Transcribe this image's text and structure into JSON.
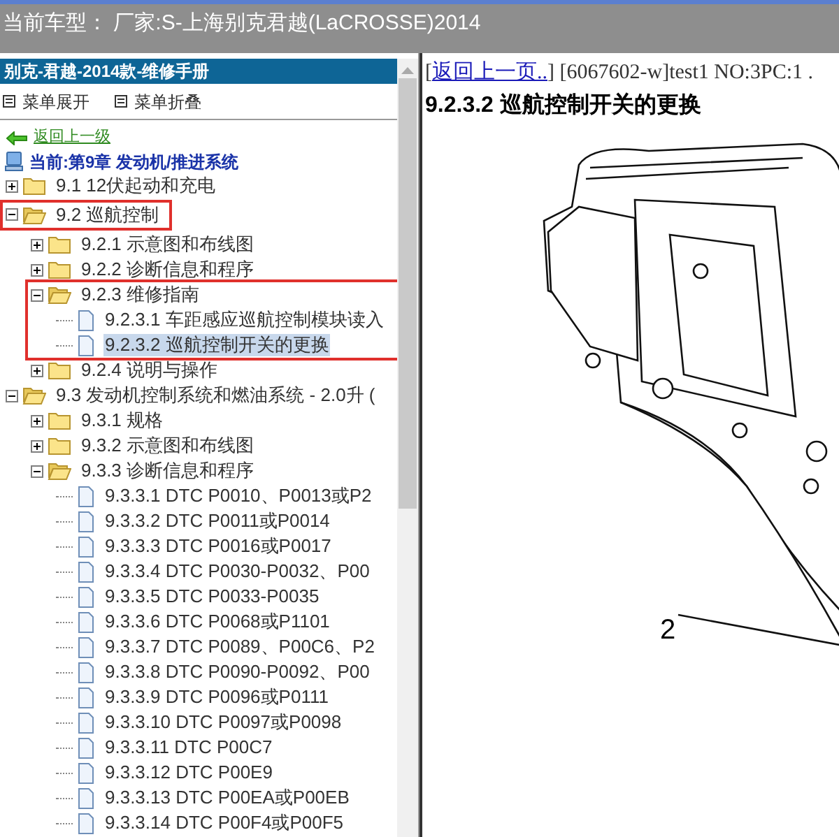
{
  "window": {
    "title": "当前车型： 厂家:S-上海别克君越(LaCROSSE)2014"
  },
  "sidebar": {
    "header": "别克-君越-2014款-维修手册",
    "menu": [
      {
        "label": "菜单展开"
      },
      {
        "label": "菜单折叠"
      }
    ],
    "back_link": "返回上一级",
    "current": "当前:第9章 发动机/推进系统",
    "tree": [
      {
        "kind": "folder",
        "label": "9.1 12伏起动和充电",
        "expanded": false,
        "selected": false
      },
      {
        "kind": "folder",
        "label": "9.2 巡航控制",
        "expanded": true,
        "selected": false,
        "highlighted": true,
        "frame_includes_children": false,
        "children": [
          {
            "kind": "folder",
            "label": "9.2.1 示意图和布线图",
            "expanded": false,
            "selected": false
          },
          {
            "kind": "folder",
            "label": "9.2.2 诊断信息和程序",
            "expanded": false,
            "selected": false
          },
          {
            "kind": "folder",
            "label": "9.2.3 维修指南",
            "expanded": true,
            "selected": false,
            "highlighted": true,
            "frame_includes_children": true,
            "children": [
              {
                "kind": "page",
                "label": "9.2.3.1 车距感应巡航控制模块读入",
                "selected": false
              },
              {
                "kind": "page",
                "label": "9.2.3.2 巡航控制开关的更换",
                "selected": true
              }
            ]
          },
          {
            "kind": "folder",
            "label": "9.2.4 说明与操作",
            "expanded": false,
            "selected": false
          }
        ]
      },
      {
        "kind": "folder",
        "label": "9.3 发动机控制系统和燃油系统 - 2.0升 (",
        "expanded": true,
        "selected": false,
        "children": [
          {
            "kind": "folder",
            "label": "9.3.1 规格",
            "expanded": false,
            "selected": false
          },
          {
            "kind": "folder",
            "label": "9.3.2 示意图和布线图",
            "expanded": false,
            "selected": false
          },
          {
            "kind": "folder",
            "label": "9.3.3 诊断信息和程序",
            "expanded": true,
            "selected": false,
            "children": [
              {
                "kind": "page",
                "label": "9.3.3.1 DTC P0010、P0013或P2",
                "selected": false
              },
              {
                "kind": "page",
                "label": "9.3.3.2 DTC P0011或P0014",
                "selected": false
              },
              {
                "kind": "page",
                "label": "9.3.3.3 DTC P0016或P0017",
                "selected": false
              },
              {
                "kind": "page",
                "label": "9.3.3.4 DTC P0030-P0032、P00",
                "selected": false
              },
              {
                "kind": "page",
                "label": "9.3.3.5 DTC P0033-P0035",
                "selected": false
              },
              {
                "kind": "page",
                "label": "9.3.3.6 DTC P0068或P1101",
                "selected": false
              },
              {
                "kind": "page",
                "label": "9.3.3.7 DTC P0089、P00C6、P2",
                "selected": false
              },
              {
                "kind": "page",
                "label": "9.3.3.8 DTC P0090-P0092、P00",
                "selected": false
              },
              {
                "kind": "page",
                "label": "9.3.3.9 DTC P0096或P0111",
                "selected": false
              },
              {
                "kind": "page",
                "label": "9.3.3.10 DTC P0097或P0098",
                "selected": false
              },
              {
                "kind": "page",
                "label": "9.3.3.11 DTC P00C7",
                "selected": false
              },
              {
                "kind": "page",
                "label": "9.3.3.12 DTC P00E9",
                "selected": false
              },
              {
                "kind": "page",
                "label": "9.3.3.13 DTC P00EA或P00EB",
                "selected": false
              },
              {
                "kind": "page",
                "label": "9.3.3.14 DTC P00F4或P00F5",
                "selected": false
              }
            ]
          }
        ]
      }
    ]
  },
  "content": {
    "line_prefix": "[",
    "back_link": "返回上一页..",
    "info": "] [6067602-w]test1 NO:3PC:1 .",
    "title": "9.2.3.2 巡航控制开关的更换",
    "callouts": [
      "2"
    ]
  }
}
